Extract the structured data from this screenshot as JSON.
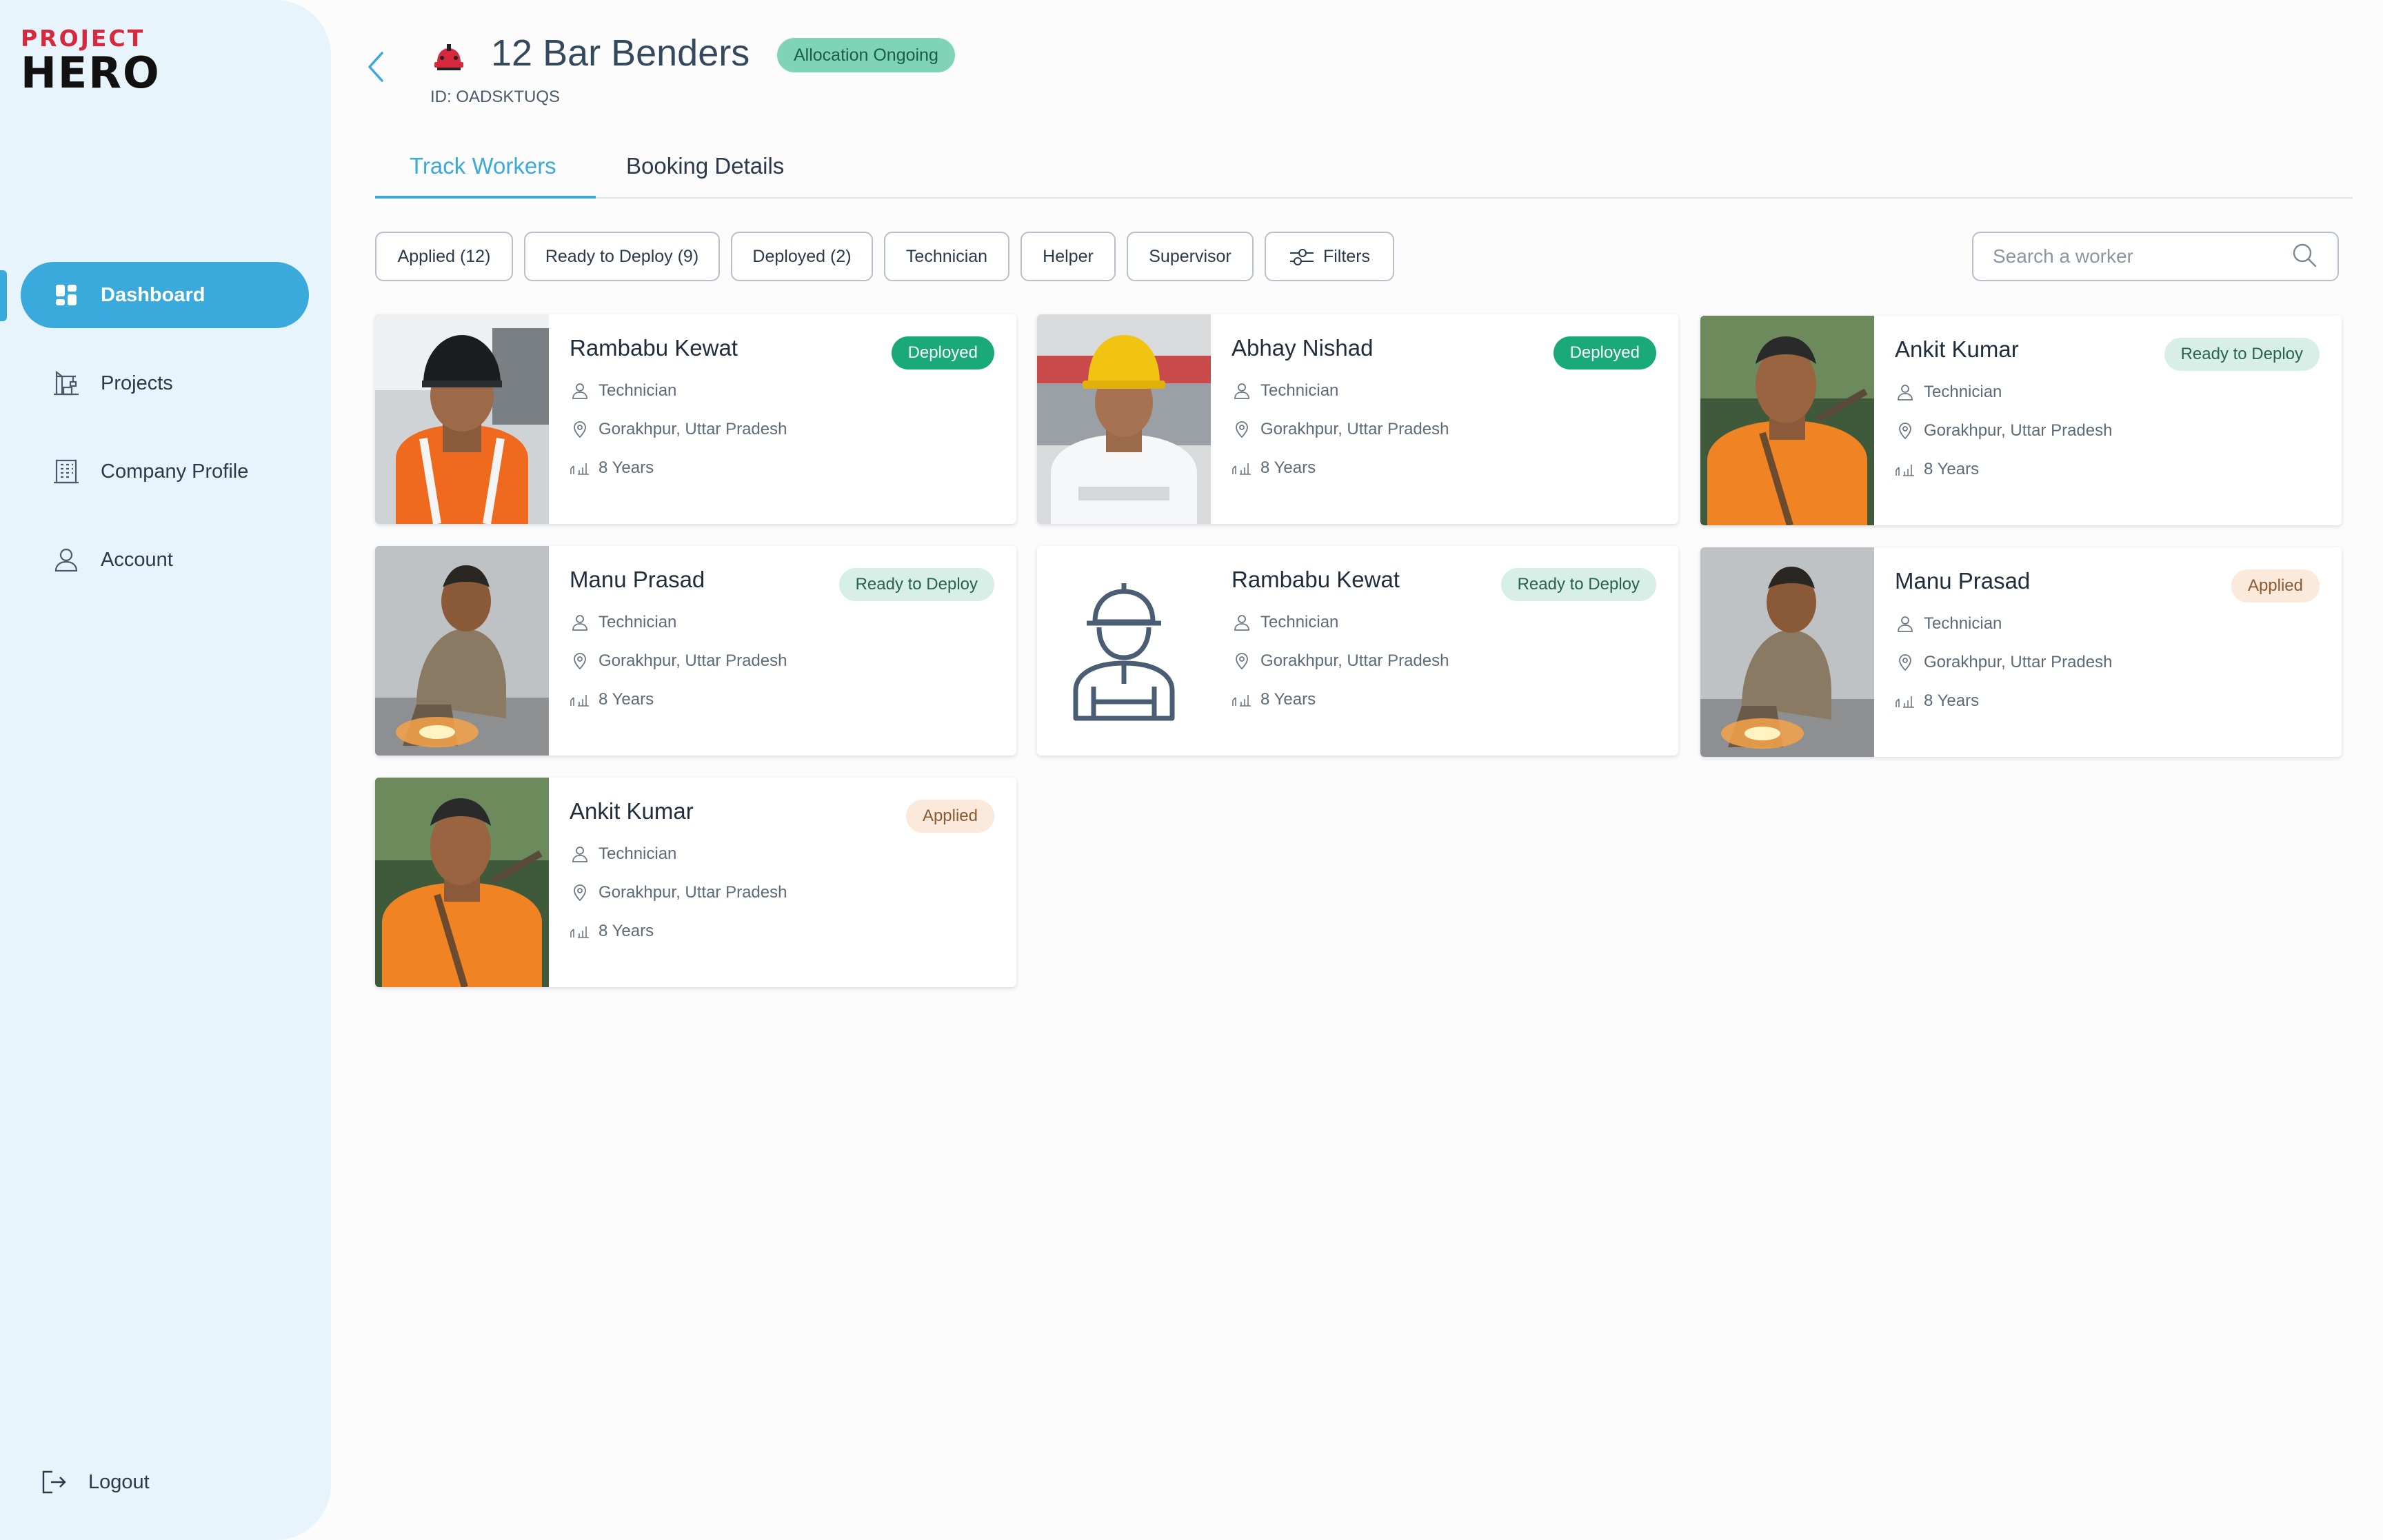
{
  "brand": {
    "line1": "PROJECT",
    "line2": "HERO"
  },
  "sidebar": {
    "items": [
      {
        "label": "Dashboard"
      },
      {
        "label": "Projects"
      },
      {
        "label": "Company Profile"
      },
      {
        "label": "Account"
      }
    ],
    "active": "Dashboard",
    "logout_label": "Logout"
  },
  "header": {
    "title": "12 Bar Benders",
    "status": "Allocation Ongoing",
    "id_text": "ID: OADSKTUQS"
  },
  "tabs": [
    {
      "label": "Track Workers",
      "active": true
    },
    {
      "label": "Booking Details",
      "active": false
    }
  ],
  "filters": {
    "chips": [
      {
        "label": "Applied (12)"
      },
      {
        "label": "Ready to Deploy (9)"
      },
      {
        "label": "Deployed (2)"
      },
      {
        "label": "Technician"
      },
      {
        "label": "Helper"
      },
      {
        "label": "Supervisor"
      }
    ],
    "filters_label": "Filters",
    "search_placeholder": "Search a worker"
  },
  "workers": [
    {
      "name": "Rambabu Kewat",
      "status": "Deployed",
      "role": "Technician",
      "location": "Gorakhpur, Uttar Pradesh",
      "experience": "8 Years",
      "photo": "welder-helmet"
    },
    {
      "name": "Abhay Nishad",
      "status": "Deployed",
      "role": "Technician",
      "location": "Gorakhpur, Uttar Pradesh",
      "experience": "8 Years",
      "photo": "yellow-hardhat"
    },
    {
      "name": "Ankit Kumar",
      "status": "Ready to Deploy",
      "role": "Technician",
      "location": "Gorakhpur, Uttar Pradesh",
      "experience": "8 Years",
      "photo": "orange-shirt"
    },
    {
      "name": "Manu Prasad",
      "status": "Ready to Deploy",
      "role": "Technician",
      "location": "Gorakhpur, Uttar Pradesh",
      "experience": "8 Years",
      "photo": "crouching-welder"
    },
    {
      "name": "Rambabu Kewat",
      "status": "Ready to Deploy",
      "role": "Technician",
      "location": "Gorakhpur, Uttar Pradesh",
      "experience": "8 Years",
      "photo": "worker-placeholder-icon"
    },
    {
      "name": "Manu Prasad",
      "status": "Applied",
      "role": "Technician",
      "location": "Gorakhpur, Uttar Pradesh",
      "experience": "8 Years",
      "photo": "crouching-welder"
    },
    {
      "name": "Ankit Kumar",
      "status": "Applied",
      "role": "Technician",
      "location": "Gorakhpur, Uttar Pradesh",
      "experience": "8 Years",
      "photo": "orange-shirt"
    }
  ],
  "colors": {
    "accent": "#3aa9dc",
    "brand_red": "#d6293d",
    "deployed": "#1aa978",
    "ready": "#d7efe6",
    "applied": "#fbeadb",
    "allocation_pill": "#7fd3b6",
    "sidebar_bg": "#e8f4fb"
  }
}
